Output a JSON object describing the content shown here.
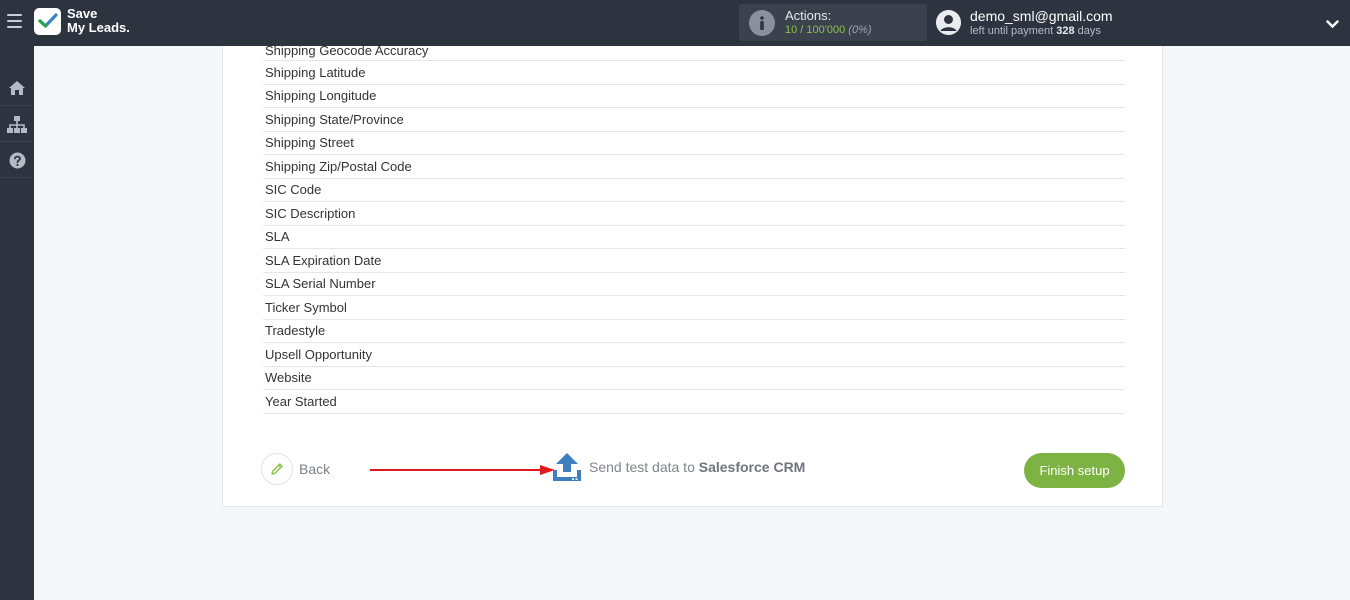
{
  "logo": {
    "line1": "Save",
    "line2": "My Leads."
  },
  "actions": {
    "label": "Actions:",
    "used": "10 / 100'000",
    "percent": "(0%)"
  },
  "user": {
    "email": "demo_sml@gmail.com",
    "payment_prefix": "left until payment",
    "days": "328",
    "days_suffix": "days"
  },
  "fields": [
    "Shipping Geocode Accuracy",
    "Shipping Latitude",
    "Shipping Longitude",
    "Shipping State/Province",
    "Shipping Street",
    "Shipping Zip/Postal Code",
    "SIC Code",
    "SIC Description",
    "SLA",
    "SLA Expiration Date",
    "SLA Serial Number",
    "Ticker Symbol",
    "Tradestyle",
    "Upsell Opportunity",
    "Website",
    "Year Started"
  ],
  "footer": {
    "back_label": "Back",
    "send_prefix": "Send test data to",
    "send_target": "Salesforce CRM",
    "finish_label": "Finish setup"
  },
  "colors": {
    "topbar": "#2d3440",
    "accent_green": "#7cb342",
    "arrow_red": "#e0191f",
    "upload_blue": "#3f7fbf"
  },
  "icons": [
    "menu-icon",
    "check-icon",
    "info-icon",
    "user-icon",
    "chevron-down-icon",
    "home-icon",
    "sitemap-icon",
    "help-icon",
    "pencil-icon",
    "upload-icon"
  ]
}
